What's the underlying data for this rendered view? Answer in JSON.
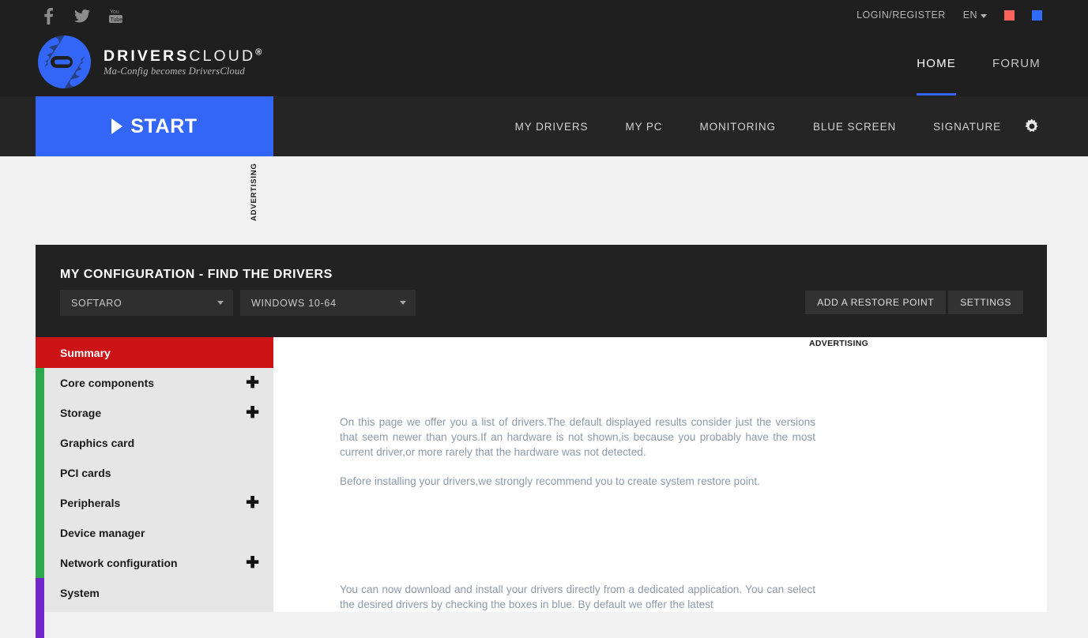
{
  "topbar": {
    "social": [
      {
        "name": "facebook-icon",
        "label": "Facebook"
      },
      {
        "name": "twitter-icon",
        "label": "Twitter"
      },
      {
        "name": "youtube-icon",
        "label": "YouTube"
      }
    ],
    "login_label": "LOGIN/REGISTER",
    "language": "EN",
    "swatch_red": "#f9645c",
    "swatch_blue": "#2f6bf6"
  },
  "brand": {
    "name_bold": "DRIVERS",
    "name_light": "CLOUD",
    "registered": "®",
    "tagline": "Ma-Config becomes DriversCloud"
  },
  "mainnav": {
    "items": [
      {
        "label": "HOME",
        "active": true
      },
      {
        "label": "FORUM",
        "active": false
      }
    ]
  },
  "subnav": {
    "start_label": "START",
    "items": [
      {
        "label": "MY DRIVERS"
      },
      {
        "label": "MY PC"
      },
      {
        "label": "MONITORING"
      },
      {
        "label": "BLUE SCREEN"
      },
      {
        "label": "SIGNATURE"
      }
    ],
    "gear_icon": "gear-icon"
  },
  "ads": {
    "top_label": "ADVERTISING",
    "inline_label": "ADVERTISING"
  },
  "config": {
    "title": "MY CONFIGURATION - FIND THE DRIVERS",
    "select_profile": "SOFTARO",
    "select_os": "WINDOWS 10-64",
    "btn_restore": "ADD A RESTORE POINT",
    "btn_settings": "SETTINGS"
  },
  "sidemenu": {
    "items": [
      {
        "label": "Summary",
        "expandable": false,
        "state": "active"
      },
      {
        "label": "Core components",
        "expandable": true
      },
      {
        "label": "Storage",
        "expandable": true
      },
      {
        "label": "Graphics card",
        "expandable": false
      },
      {
        "label": "PCI cards",
        "expandable": false
      },
      {
        "label": "Peripherals",
        "expandable": true
      },
      {
        "label": "Device manager",
        "expandable": false
      },
      {
        "label": "Network configuration",
        "expandable": true
      },
      {
        "label": "System",
        "expandable": false
      }
    ],
    "expand_glyph": "✚",
    "accent_active": "#cc1417",
    "accent_group_green": "#2ea84f",
    "accent_group_purple": "#7326cc"
  },
  "article": {
    "para1": "On this page we offer you a list of drivers.The default displayed results consider just the versions that seem newer than yours.If an hardware is not shown,is because you probably have the most current driver,or more rarely that the hardware was not detected.",
    "para2": "Before installing your drivers,we strongly recommend you to create system restore point.",
    "para3": "You can now download and install your drivers directly from a dedicated application. You can select the desired drivers by checking the boxes in blue. By default we offer the latest"
  }
}
